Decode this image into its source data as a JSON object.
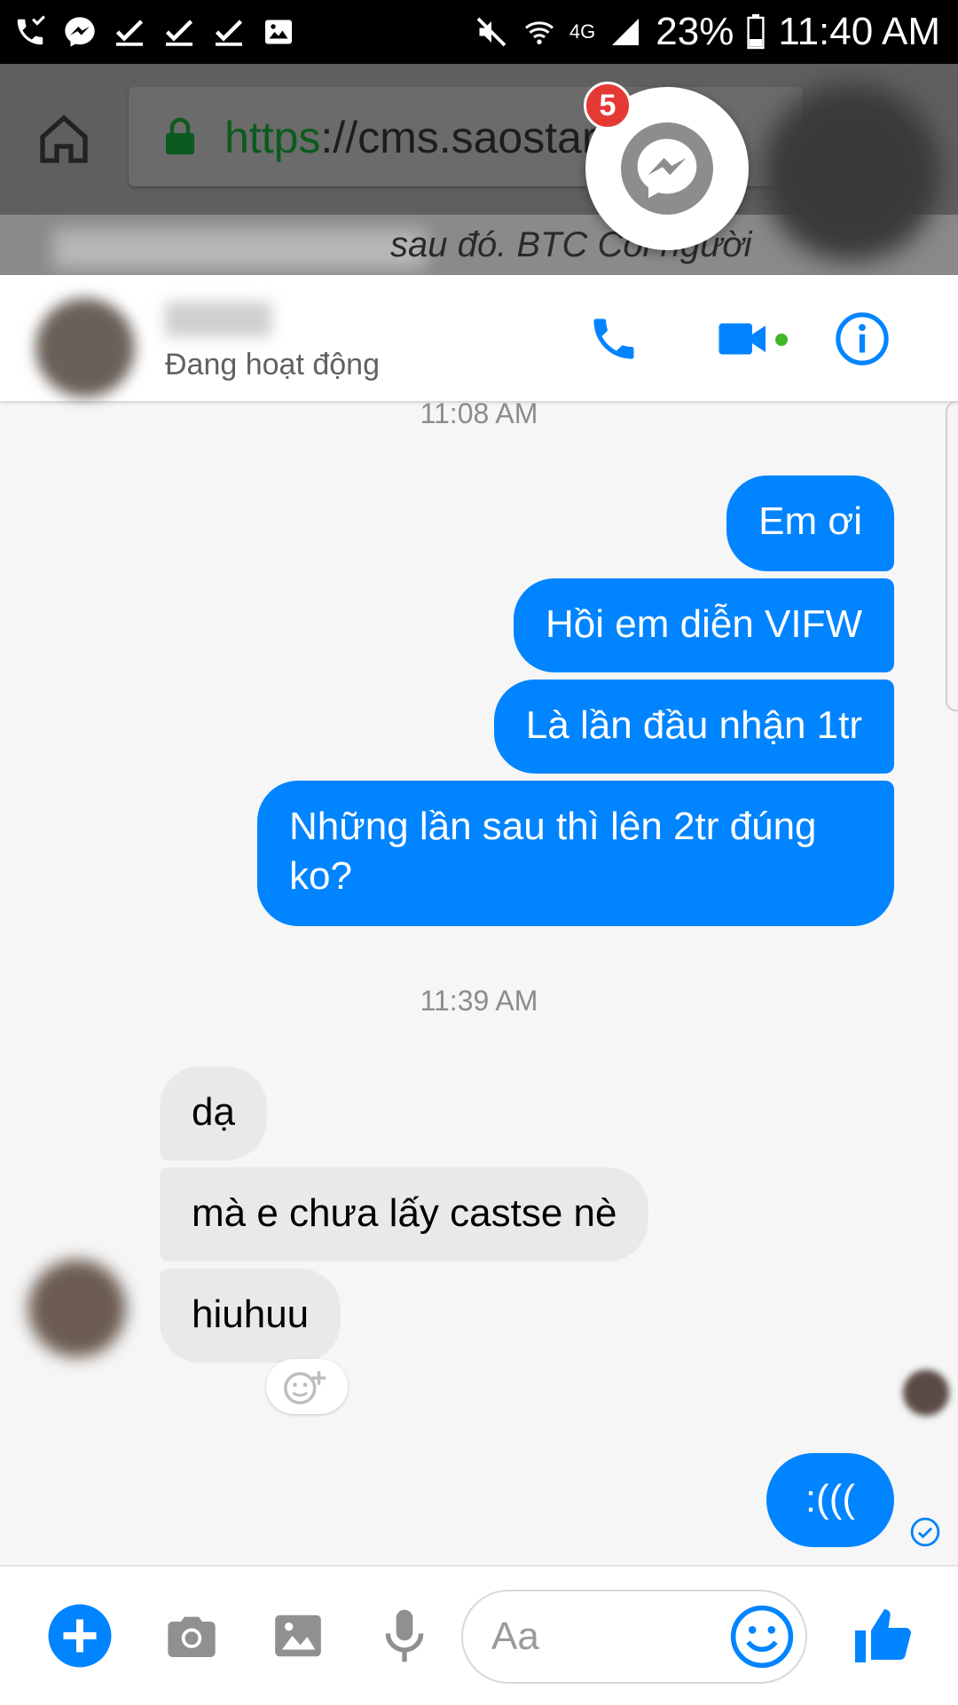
{
  "status_bar": {
    "battery_percent": "23%",
    "time": "11:40 AM",
    "network_label": "4G"
  },
  "browser": {
    "url_protocol": "https",
    "url_rest": "://cms.saostar",
    "page_peek_text": "sau đó. BTC Coi người"
  },
  "chat_head": {
    "badge_count": "5"
  },
  "conversation": {
    "status": "Đang hoạt động"
  },
  "messages": {
    "timestamp_1": "11:08 AM",
    "out_1": "Em ơi",
    "out_2": "Hồi em diễn VIFW",
    "out_3": "Là lần đầu nhận 1tr",
    "out_4": "Những lần sau thì lên 2tr đúng ko?",
    "timestamp_2": "11:39 AM",
    "in_1": "dạ",
    "in_2": "mà e chưa lấy castse nè",
    "in_3": "hiuhuu",
    "out_5": ":((("
  },
  "composer": {
    "placeholder": "Aa"
  },
  "colors": {
    "messenger_blue": "#0084ff",
    "incoming_bubble": "#e9e9e9",
    "online_green": "#42b72a",
    "badge_red": "#e53935"
  },
  "icons": [
    "missed-call-icon",
    "messenger-icon",
    "check-icon",
    "image-icon",
    "mute-icon",
    "wifi-icon",
    "signal-icon",
    "battery-icon",
    "home-icon",
    "lock-icon",
    "phone-icon",
    "video-icon",
    "info-icon",
    "add-icon",
    "camera-icon",
    "gallery-icon",
    "mic-icon",
    "emoji-icon",
    "like-icon",
    "add-reaction-icon",
    "delivered-icon"
  ]
}
